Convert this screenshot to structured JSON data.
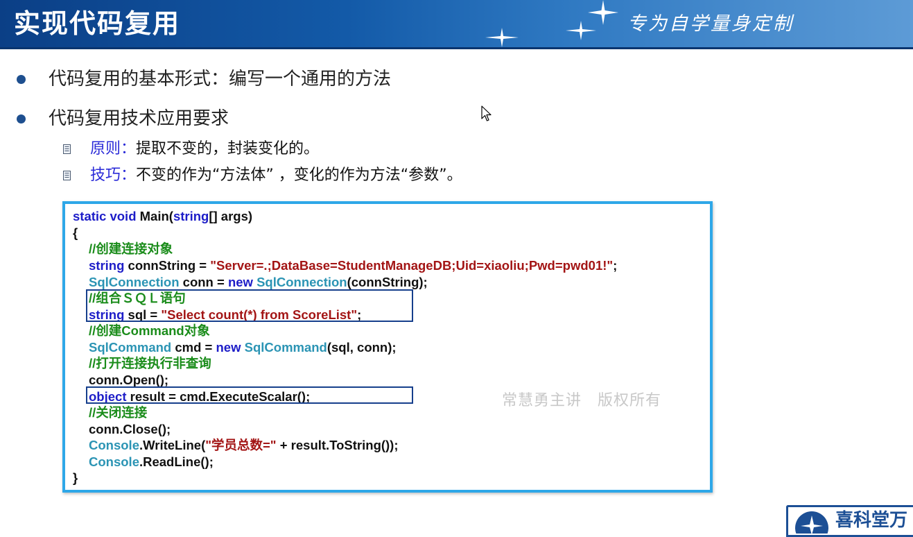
{
  "header": {
    "title": "实现代码复用",
    "tagline": "专为自学量身定制"
  },
  "bullets": [
    {
      "text": "代码复用的基本形式：编写一个通用的方法"
    },
    {
      "text": "代码复用技术应用要求"
    }
  ],
  "sub_items": [
    {
      "label": "原则：",
      "text": "提取不变的，封装变化的。"
    },
    {
      "label": "技巧：",
      "text": "不变的作为“方法体” ，变化的作为方法“参数”。"
    }
  ],
  "code": {
    "l01a": "static void",
    "l01b": " Main(",
    "l01c": "string",
    "l01d": "[] args)",
    "l02": "{",
    "l03": "//创建连接对象",
    "l04a": "string",
    "l04b": " connString = ",
    "l04c": "\"Server=.;DataBase=StudentManageDB;Uid=xiaoliu;Pwd=pwd01!\"",
    "l04d": ";",
    "l05a": "SqlConnection",
    "l05b": " conn = ",
    "l05c": "new",
    "l05d": " ",
    "l05e": "SqlConnection",
    "l05f": "(connString);",
    "l06": "//组合ＳＱＬ语句",
    "l07a": "string",
    "l07b": " sql = ",
    "l07c": "\"Select count(*) from ScoreList\"",
    "l07d": ";",
    "l08": "//创建Command对象",
    "l09a": "SqlCommand",
    "l09b": " cmd = ",
    "l09c": "new",
    "l09d": " ",
    "l09e": "SqlCommand",
    "l09f": "(sql, conn);",
    "l10": "//打开连接执行非查询",
    "l11": "conn.Open();",
    "l12a": "object",
    "l12b": " result = cmd.ExecuteScalar();",
    "l13": "//关闭连接",
    "l14": "conn.Close();",
    "l15a": "Console",
    "l15b": ".WriteLine(",
    "l15c": "\"学员总数=\"",
    "l15d": " + result.ToString());",
    "l16a": "Console",
    "l16b": ".ReadLine();",
    "l17": "}"
  },
  "watermark": "常慧勇主讲　版权所有",
  "logo": {
    "text": "喜科堂万"
  },
  "colors": {
    "header_blue": "#135aa8",
    "bullet_dot": "#1e4f8f",
    "sub_label": "#2a2ad8",
    "code_border": "#2ea7e8",
    "keyword": "#1d1dc8",
    "type": "#2b94b4",
    "string": "#a31515",
    "comment": "#1a8c1a",
    "highlight_box": "#163f8c"
  },
  "icons": {
    "bullet": "filled-circle",
    "sub_bullet": "document-lines-icon",
    "star": "four-point-star-icon",
    "cursor": "mouse-pointer-icon"
  }
}
